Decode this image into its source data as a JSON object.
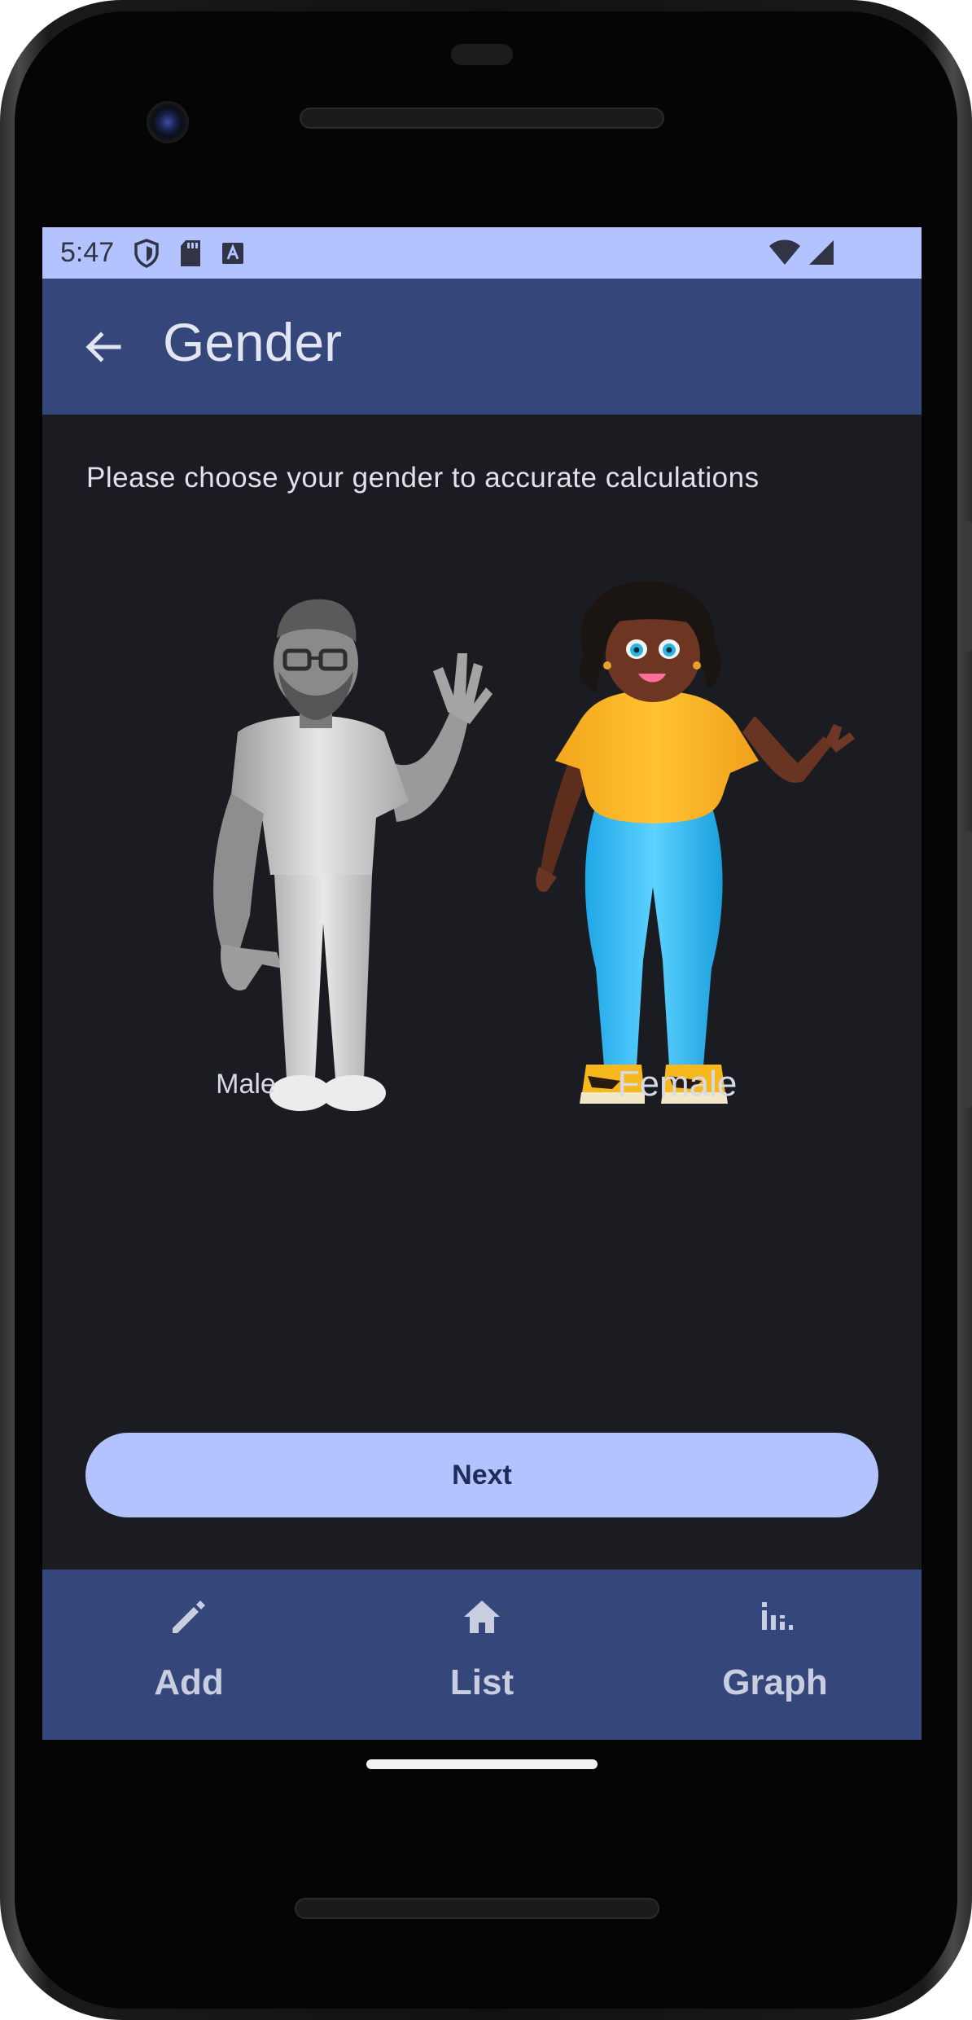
{
  "status_bar": {
    "time": "5:47",
    "left_icons": [
      "shield-icon",
      "sd-card-icon",
      "font-icon"
    ],
    "right_icons": [
      "wifi-icon",
      "cellular-signal-icon"
    ],
    "background": "#b2c3ff"
  },
  "app_bar": {
    "title": "Gender",
    "back_icon": "arrow-back-icon",
    "background": "#34467a"
  },
  "main": {
    "subtitle": "Please choose your gender to accurate calculations",
    "options": [
      {
        "label": "Male",
        "selected": false
      },
      {
        "label": "Female",
        "selected": true
      }
    ],
    "next_label": "Next",
    "background": "#1b1c21"
  },
  "bottom_nav": {
    "items": [
      {
        "label": "Add",
        "icon": "pencil-icon"
      },
      {
        "label": "List",
        "icon": "home-icon"
      },
      {
        "label": "Graph",
        "icon": "bar-chart-icon"
      }
    ],
    "background": "#34467a"
  },
  "colors": {
    "accent": "#b2c3ff",
    "primary": "#34467a",
    "on_accent": "#1e2c5a"
  }
}
